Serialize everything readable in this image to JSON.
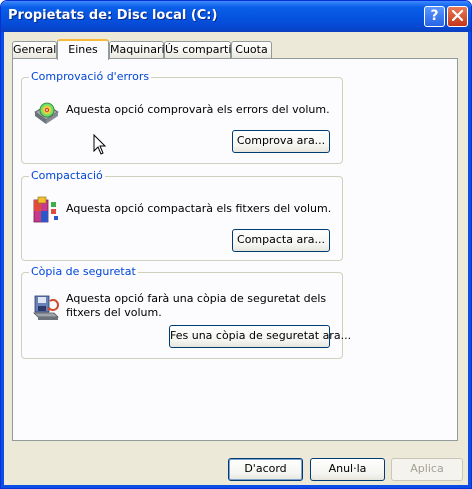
{
  "window": {
    "title": "Propietats de: Disc local (C:)",
    "help_icon": "help-icon",
    "close_icon": "close-icon"
  },
  "tabs": [
    {
      "label": "General",
      "active": false
    },
    {
      "label": "Eines",
      "active": true
    },
    {
      "label": "Maquinari",
      "active": false
    },
    {
      "label": "Ús compartit",
      "active": false
    },
    {
      "label": "Cuota",
      "active": false
    }
  ],
  "groups": {
    "error_check": {
      "label": "Comprovació d'errors",
      "description": "Aquesta opció comprovarà els errors del volum.",
      "button": "Comprova ara...",
      "icon": "disk-check-icon"
    },
    "defrag": {
      "label": "Compactació",
      "description": "Aquesta opció compactarà els fitxers del volum.",
      "button": "Compacta ara...",
      "icon": "defrag-icon"
    },
    "backup": {
      "label": "Còpia de seguretat",
      "description": "Aquesta opció farà una còpia de seguretat dels fitxers del volum.",
      "button": "Fes una còpia de seguretat ara...",
      "icon": "backup-icon"
    }
  },
  "footer": {
    "ok": "D'acord",
    "cancel": "Anul·la",
    "apply": "Aplica"
  },
  "colors": {
    "titlebar": "#0553e0",
    "group_label": "#0046d5",
    "active_tab_accent": "#f6b93b",
    "dialog_bg": "#ece9d8"
  }
}
